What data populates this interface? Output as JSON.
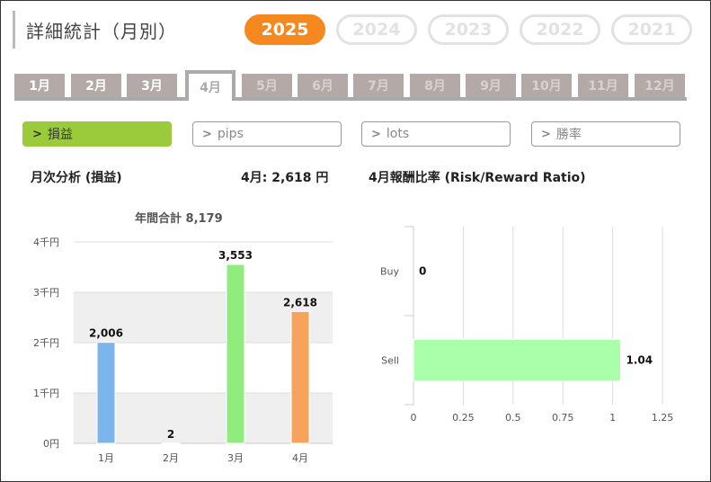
{
  "header": {
    "title": "詳細統計（月別）",
    "years": [
      {
        "label": "2025",
        "active": true
      },
      {
        "label": "2024",
        "active": false
      },
      {
        "label": "2023",
        "active": false
      },
      {
        "label": "2022",
        "active": false
      },
      {
        "label": "2021",
        "active": false
      }
    ]
  },
  "months": [
    {
      "label": "1月",
      "state": "enabled"
    },
    {
      "label": "2月",
      "state": "enabled"
    },
    {
      "label": "3月",
      "state": "enabled"
    },
    {
      "label": "4月",
      "state": "active"
    },
    {
      "label": "5月",
      "state": "disabled"
    },
    {
      "label": "6月",
      "state": "disabled"
    },
    {
      "label": "7月",
      "state": "disabled"
    },
    {
      "label": "8月",
      "state": "disabled"
    },
    {
      "label": "9月",
      "state": "disabled"
    },
    {
      "label": "10月",
      "state": "disabled"
    },
    {
      "label": "11月",
      "state": "disabled"
    },
    {
      "label": "12月",
      "state": "disabled"
    }
  ],
  "metrics": [
    {
      "label": "損益",
      "active": true
    },
    {
      "label": "pips",
      "active": false
    },
    {
      "label": "lots",
      "active": false
    },
    {
      "label": "勝率",
      "active": false
    }
  ],
  "left_section": {
    "title": "月次分析 (損益)",
    "current_label": "4月:",
    "current_value": "2,618 円",
    "annual_total": "年間合計 8,179"
  },
  "right_section": {
    "title": "4月報酬比率 (Risk/Reward Ratio)"
  },
  "colors": {
    "accent": "#f5891f",
    "active_metric": "#9bcb3b",
    "bar_jan": "#7cb5ec",
    "bar_feb": "#7cb5ec",
    "bar_mar": "#90ed7d",
    "bar_apr": "#f7a35c",
    "sell_bar": "#aaffaa"
  },
  "chart_data": [
    {
      "type": "bar",
      "categories": [
        "1月",
        "2月",
        "3月",
        "4月"
      ],
      "values": [
        2006,
        2,
        3553,
        2618
      ],
      "data_labels": [
        "2,006",
        "2",
        "3,553",
        "2,618"
      ],
      "colors": [
        "#7cb5ec",
        "#7cb5ec",
        "#90ed7d",
        "#f7a35c"
      ],
      "title": "年間合計 8,179",
      "ylim": [
        0,
        4000
      ],
      "yticks": [
        0,
        1000,
        2000,
        3000,
        4000
      ],
      "ytick_labels": [
        "0円",
        "1千円",
        "2千円",
        "3千円",
        "4千円"
      ],
      "grid": true
    },
    {
      "type": "bar",
      "orientation": "horizontal",
      "categories": [
        "Buy",
        "Sell"
      ],
      "values": [
        0,
        1.04
      ],
      "data_labels": [
        "0",
        "1.04"
      ],
      "colors": [
        "#aaffaa",
        "#aaffaa"
      ],
      "xlim": [
        0,
        1.25
      ],
      "xticks": [
        0,
        0.25,
        0.5,
        0.75,
        1,
        1.25
      ],
      "xtick_labels": [
        "0",
        "0.25",
        "0.5",
        "0.75",
        "1",
        "1.25"
      ],
      "grid": true
    }
  ]
}
